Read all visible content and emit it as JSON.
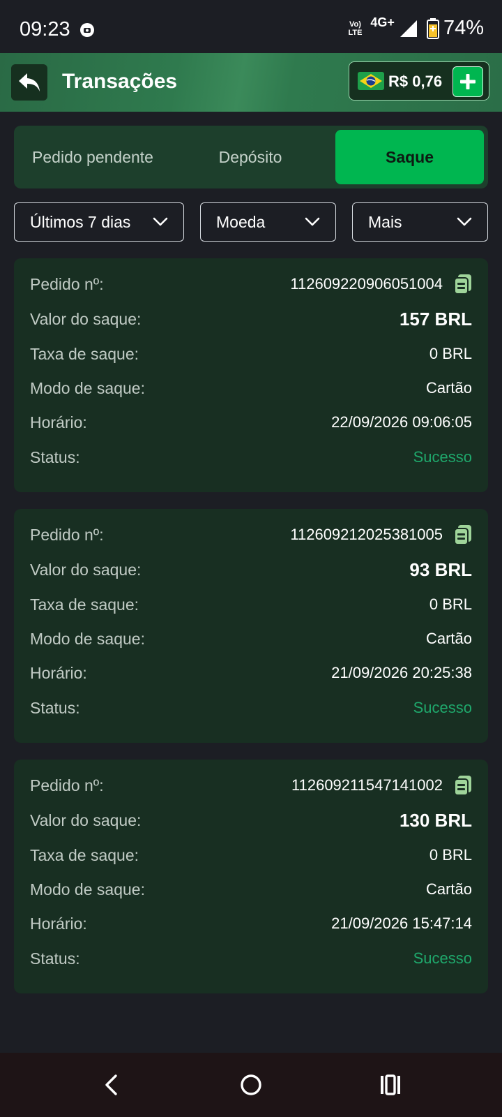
{
  "status_bar": {
    "time": "09:23",
    "volte": "Vo) LTE",
    "network": "4G+",
    "battery": "74%"
  },
  "header": {
    "title": "Transações",
    "balance": "R$ 0,76"
  },
  "tabs": [
    {
      "label": "Pedido pendente",
      "active": false
    },
    {
      "label": "Depósito",
      "active": false
    },
    {
      "label": "Saque",
      "active": true
    }
  ],
  "filters": [
    {
      "label": "Últimos 7 dias"
    },
    {
      "label": "Moeda"
    },
    {
      "label": "Mais"
    }
  ],
  "labels": {
    "order": "Pedido nº:",
    "amount": "Valor do saque:",
    "fee": "Taxa de saque:",
    "mode": "Modo de saque:",
    "time": "Horário:",
    "status": "Status:"
  },
  "transactions": [
    {
      "order": "112609220906051004",
      "amount": "157 BRL",
      "fee": "0 BRL",
      "mode": "Cartão",
      "time": "22/09/2026 09:06:05",
      "status": "Sucesso"
    },
    {
      "order": "112609212025381005",
      "amount": "93 BRL",
      "fee": "0 BRL",
      "mode": "Cartão",
      "time": "21/09/2026 20:25:38",
      "status": "Sucesso"
    },
    {
      "order": "112609211547141002",
      "amount": "130 BRL",
      "fee": "0 BRL",
      "mode": "Cartão",
      "time": "21/09/2026 15:47:14",
      "status": "Sucesso"
    }
  ],
  "colors": {
    "accent": "#00b650",
    "success": "#1fa86c",
    "card": "#182f22",
    "background": "#1c1e24"
  },
  "icons": [
    "alarm-icon",
    "signal-icon",
    "battery-icon",
    "back-arrow-icon",
    "brazil-flag-icon",
    "plus-icon",
    "chevron-down-icon",
    "copy-icon",
    "nav-back-icon",
    "nav-home-icon",
    "nav-recents-icon"
  ]
}
